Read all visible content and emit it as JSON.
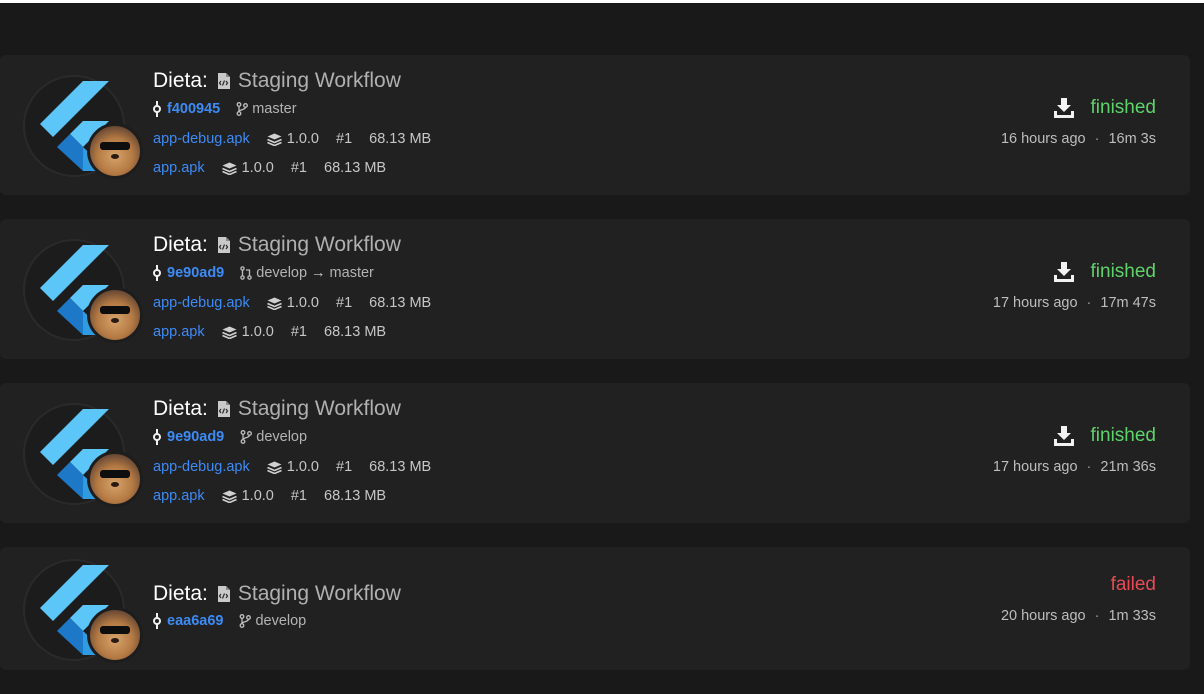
{
  "colors": {
    "background": "#191919",
    "card": "#212121",
    "link": "#3d8bf5",
    "finished": "#5ed36a",
    "failed": "#e84a55",
    "flutter_light": "#5cc6f8",
    "flutter_dark": "#1e78c8"
  },
  "icons": {
    "workflow": "file-code-icon",
    "commit": "git-commit-icon",
    "branch": "git-branch-icon",
    "pull_request": "pull-request-icon",
    "version": "layers-icon",
    "download": "download-icon",
    "app_logo": "flutter-logo",
    "user": "user-avatar"
  },
  "builds": [
    {
      "app": "Dieta:",
      "workflow": "Staging Workflow",
      "commit": "f400945",
      "branch": "master",
      "artifacts": [
        {
          "name": "app-debug.apk",
          "version": "1.0.0",
          "build": "#1",
          "size": "68.13 MB"
        },
        {
          "name": "app.apk",
          "version": "1.0.0",
          "build": "#1",
          "size": "68.13 MB"
        }
      ],
      "status": "finished",
      "started": "16 hours ago",
      "separator": "·",
      "duration": "16m 3s"
    },
    {
      "app": "Dieta:",
      "workflow": "Staging Workflow",
      "commit": "9e90ad9",
      "branch_from": "develop",
      "arrow": "→",
      "branch_to": "master",
      "artifacts": [
        {
          "name": "app-debug.apk",
          "version": "1.0.0",
          "build": "#1",
          "size": "68.13 MB"
        },
        {
          "name": "app.apk",
          "version": "1.0.0",
          "build": "#1",
          "size": "68.13 MB"
        }
      ],
      "status": "finished",
      "started": "17 hours ago",
      "separator": "·",
      "duration": "17m 47s"
    },
    {
      "app": "Dieta:",
      "workflow": "Staging Workflow",
      "commit": "9e90ad9",
      "branch": "develop",
      "artifacts": [
        {
          "name": "app-debug.apk",
          "version": "1.0.0",
          "build": "#1",
          "size": "68.13 MB"
        },
        {
          "name": "app.apk",
          "version": "1.0.0",
          "build": "#1",
          "size": "68.13 MB"
        }
      ],
      "status": "finished",
      "started": "17 hours ago",
      "separator": "·",
      "duration": "21m 36s"
    },
    {
      "app": "Dieta:",
      "workflow": "Staging Workflow",
      "commit": "eaa6a69",
      "branch": "develop",
      "status": "failed",
      "started": "20 hours ago",
      "separator": "·",
      "duration": "1m 33s"
    }
  ]
}
